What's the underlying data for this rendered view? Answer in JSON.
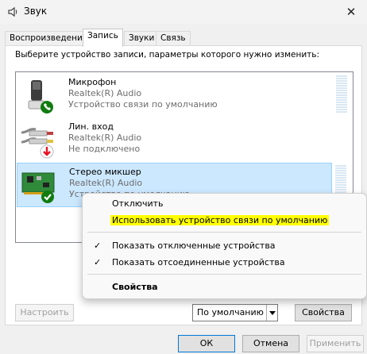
{
  "window": {
    "title": "Звук",
    "close_icon": "close-icon"
  },
  "tabs": [
    {
      "label": "Воспроизведение"
    },
    {
      "label": "Запись"
    },
    {
      "label": "Звуки"
    },
    {
      "label": "Связь"
    }
  ],
  "panel": {
    "instruction": "Выберите устройство записи, параметры которого нужно изменить:"
  },
  "devices": [
    {
      "name": "Микрофон",
      "driver": "Realtek(R) Audio",
      "status": "Устройство связи по умолчанию",
      "icon": "microphone-icon",
      "badge": "phone-badge"
    },
    {
      "name": "Лин. вход",
      "driver": "Realtek(R) Audio",
      "status": "Не подключено",
      "icon": "line-in-icon",
      "badge": "down-arrow-badge"
    },
    {
      "name": "Стерео микшер",
      "driver": "Realtek(R) Audio",
      "status": "Устройство по умолчанию",
      "icon": "sound-card-icon",
      "badge": "checkmark-badge"
    }
  ],
  "buttons": {
    "configure": "Настроить",
    "set_default": "По умолчанию",
    "properties": "Свойства",
    "ok": "ОК",
    "cancel": "Отмена",
    "apply": "Применить"
  },
  "context_menu": {
    "disable": "Отключить",
    "set_default_comm": "Использовать устройство связи по умолчанию",
    "show_disabled": "Показать отключенные устройства",
    "show_disconnected": "Показать отсоединенные устройства",
    "properties": "Свойства",
    "check_mark": "✓"
  },
  "colors": {
    "selection": "#cce8ff",
    "highlight": "#ffff00",
    "green_badge": "#107c10",
    "red_badge": "#e81123"
  }
}
